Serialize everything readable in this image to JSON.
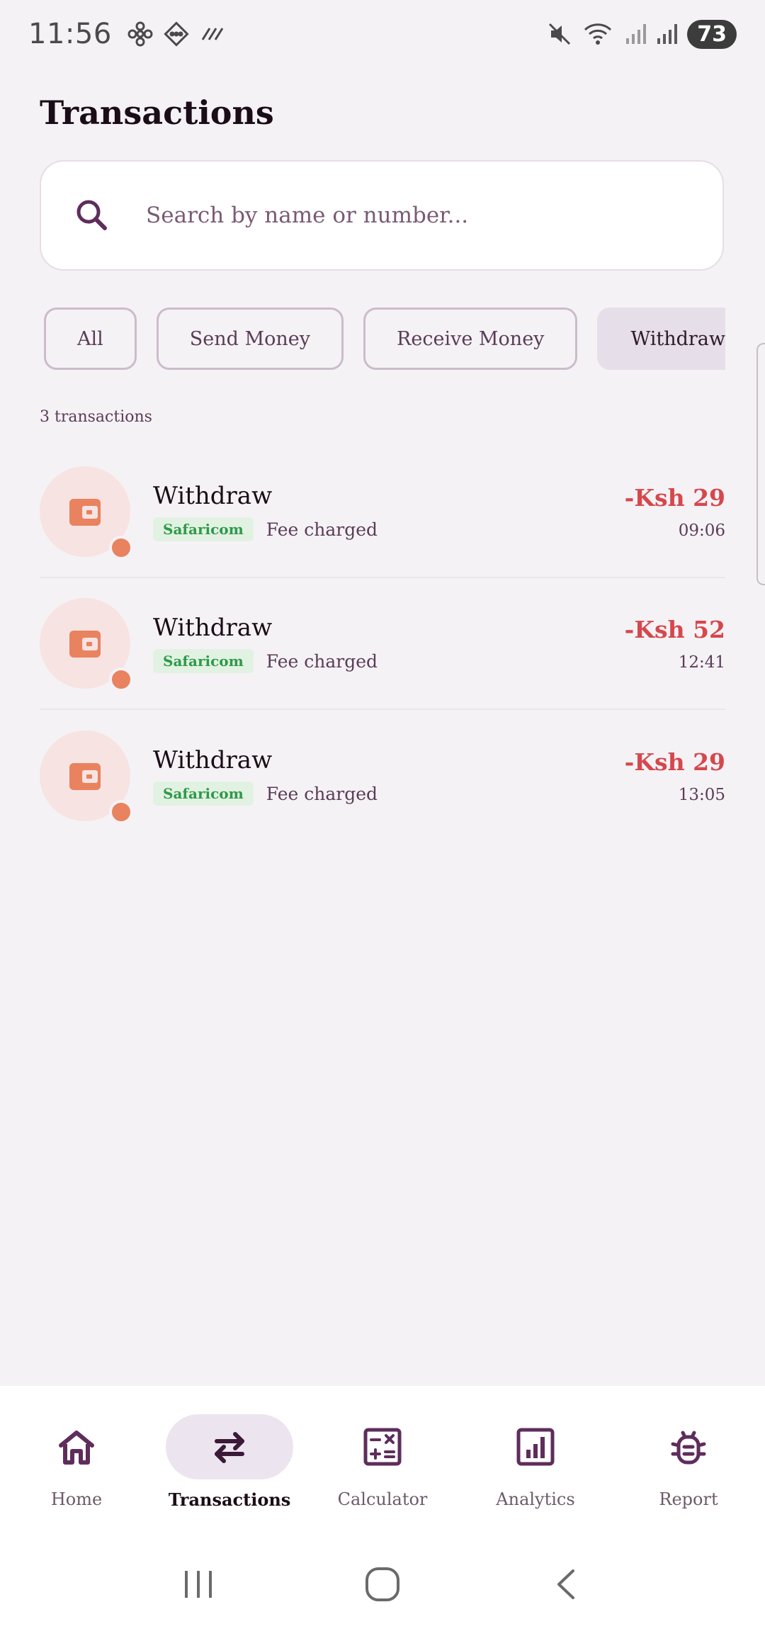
{
  "status_bar": {
    "time": "11:56",
    "battery": "73",
    "left_icons": [
      "fan-icon",
      "diamond-icon",
      "hash-icon"
    ],
    "right_icons": [
      "mute-icon",
      "wifi-icon",
      "signal-icon",
      "signal-icon"
    ]
  },
  "page": {
    "title": "Transactions"
  },
  "search": {
    "placeholder": "Search by name or number...",
    "value": ""
  },
  "filters": [
    {
      "label": "All",
      "active": false
    },
    {
      "label": "Send Money",
      "active": false
    },
    {
      "label": "Receive Money",
      "active": false
    },
    {
      "label": "Withdraw",
      "active": true
    }
  ],
  "summary": {
    "count_label": "3 transactions"
  },
  "transactions": [
    {
      "title": "Withdraw",
      "provider": "Safaricom",
      "note": "Fee charged",
      "amount": "-Ksh 29",
      "time": "09:06",
      "icon": "wallet-icon"
    },
    {
      "title": "Withdraw",
      "provider": "Safaricom",
      "note": "Fee charged",
      "amount": "-Ksh 52",
      "time": "12:41",
      "icon": "wallet-icon"
    },
    {
      "title": "Withdraw",
      "provider": "Safaricom",
      "note": "Fee charged",
      "amount": "-Ksh 29",
      "time": "13:05",
      "icon": "wallet-icon"
    }
  ],
  "bottom_nav": [
    {
      "label": "Home",
      "icon": "home-icon",
      "active": false
    },
    {
      "label": "Transactions",
      "icon": "swap-icon",
      "active": true
    },
    {
      "label": "Calculator",
      "icon": "calculator-icon",
      "active": false
    },
    {
      "label": "Analytics",
      "icon": "chart-icon",
      "active": false
    },
    {
      "label": "Report",
      "icon": "bug-icon",
      "active": false
    }
  ],
  "colors": {
    "accent": "#5e2d5c",
    "amount_negative": "#d5484c",
    "badge_bg": "#e2f2e2",
    "badge_text": "#2e9a4a",
    "avatar_bg": "#f7e3e2",
    "avatar_icon": "#e9825f"
  }
}
